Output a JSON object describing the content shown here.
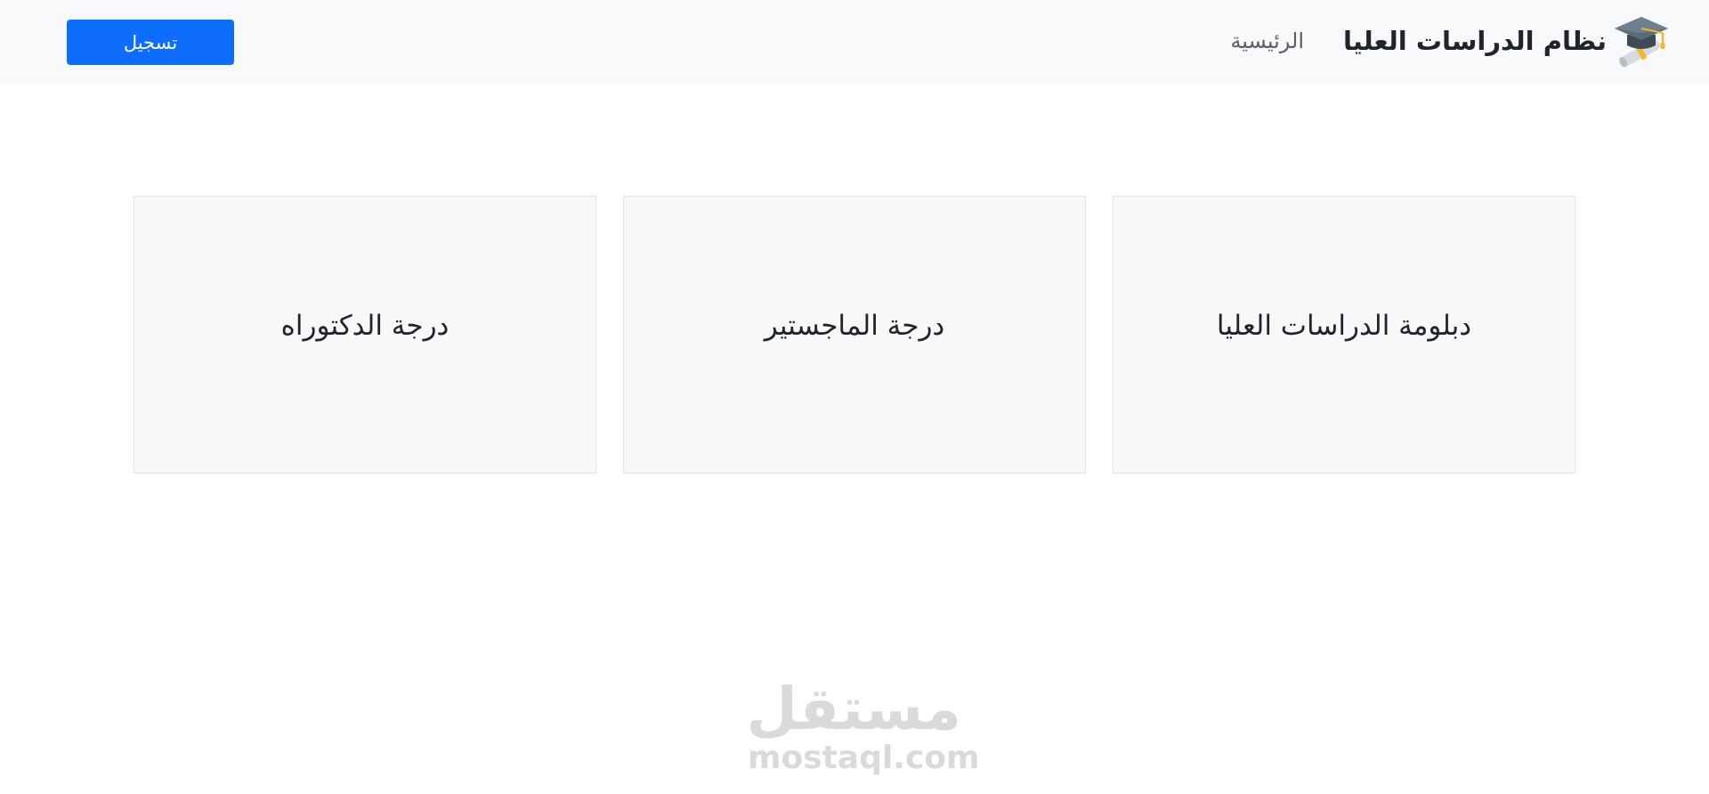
{
  "navbar": {
    "brand": {
      "title": "نظام الدراسات العليا",
      "icon": "graduation-cap-icon"
    },
    "links": [
      {
        "label": "الرئيسية"
      }
    ],
    "register_label": "تسجيل"
  },
  "cards": [
    {
      "title": "دبلومة الدراسات العليا"
    },
    {
      "title": "درجة الماجستير"
    },
    {
      "title": "درجة الدكتوراه"
    }
  ],
  "watermark": {
    "arabic": "مستقل",
    "latin": "mostaql.com"
  },
  "colors": {
    "navbar_bg": "#f8f9fa",
    "primary": "#0d6efd",
    "card_bg": "#f7f8f9",
    "card_border": "#e3e5e8",
    "watermark": "#d9dadc"
  }
}
